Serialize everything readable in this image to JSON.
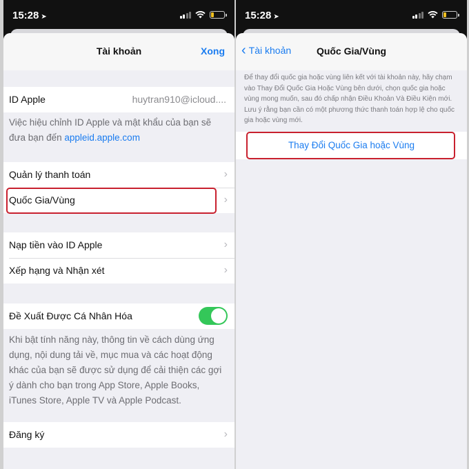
{
  "left": {
    "status": {
      "time": "15:28"
    },
    "nav": {
      "title": "Tài khoản",
      "done": "Xong"
    },
    "apple_id": {
      "label": "ID Apple",
      "value": "huytran910@icloud...."
    },
    "apple_id_footer": {
      "text": "Việc hiệu chỉnh ID Apple và mật khẩu của bạn sẽ đưa bạn đến ",
      "link": "appleid.apple.com"
    },
    "rows1": [
      "Quản lý thanh toán",
      "Quốc Gia/Vùng"
    ],
    "rows2": [
      "Nạp tiền vào ID Apple",
      "Xếp hạng và Nhận xét"
    ],
    "personalized": {
      "label": "Đề Xuất Được Cá Nhân Hóa",
      "enabled": true
    },
    "personalized_footer": "Khi bật tính năng này, thông tin về cách dùng ứng dụng, nội dung tải về, mục mua và các hoạt động khác của bạn sẽ được sử dụng để cải thiện các gợi ý dành cho bạn trong App Store, Apple Books, iTunes Store, Apple TV và Apple Podcast.",
    "subscriptions": "Đăng ký"
  },
  "right": {
    "status": {
      "time": "15:28"
    },
    "nav": {
      "back": "Tài khoản",
      "title": "Quốc Gia/Vùng"
    },
    "description": "Để thay đổi quốc gia hoặc vùng liên kết với tài khoản này, hãy chạm vào Thay Đổi Quốc Gia Hoặc Vùng bên dưới, chọn quốc gia hoặc vùng mong muốn, sau đó chấp nhận Điều Khoản Và Điều Kiện mới. Lưu ý rằng bạn cần có một phương thức thanh toán hợp lệ cho quốc gia hoặc vùng mới.",
    "action": "Thay Đổi Quốc Gia hoặc Vùng"
  },
  "colors": {
    "accent": "#1a7cf0",
    "highlight": "#c8202e",
    "toggle_on": "#34c759"
  },
  "icons": [
    "location-arrow-icon",
    "signal-icon",
    "wifi-icon",
    "battery-icon",
    "chevron-right-icon",
    "chevron-left-icon"
  ]
}
